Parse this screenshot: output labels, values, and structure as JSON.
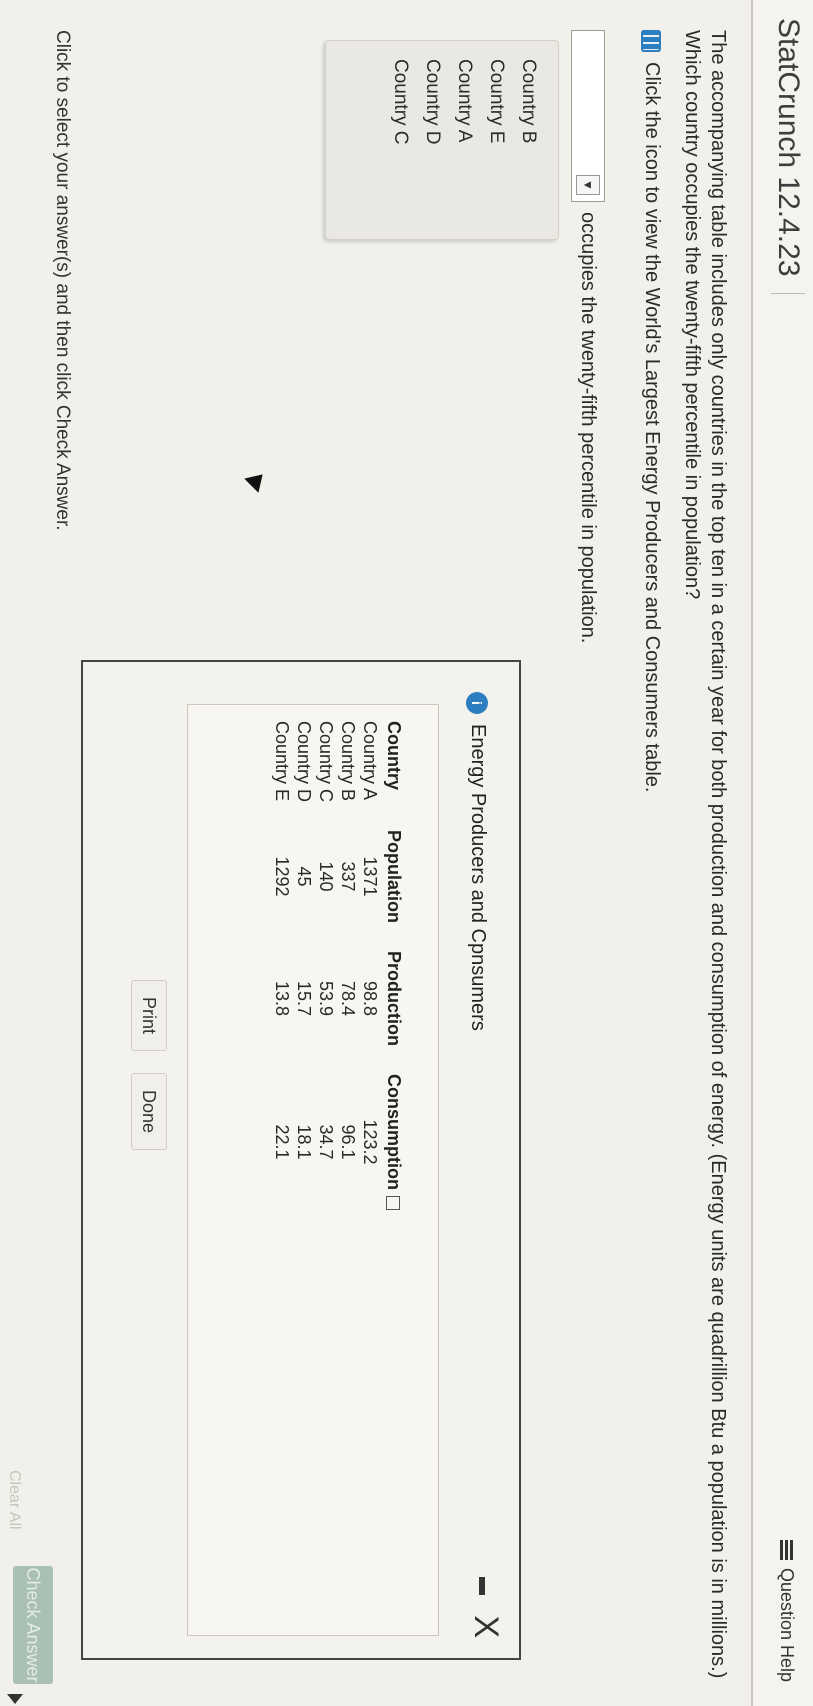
{
  "header": {
    "app_title": "StatCrunch 12.4.23",
    "question_help_label": "Question Help"
  },
  "question": {
    "text": "The accompanying table includes only countries in the top ten in a certain year for both production and consumption of energy. (Energy units are quadrillion Btu a population is in millions.) Which country occupies the twenty-fifth percentile in population?",
    "instruction": "Click the icon to view the World's Largest Energy Producers and Consumers table."
  },
  "answer": {
    "selected_value": "",
    "suffix_text": "occupies the twenty-fifth percentile in population.",
    "options": [
      "Country B",
      "Country E",
      "Country A",
      "Country D",
      "Country C"
    ]
  },
  "popup": {
    "title": "Energy Producers and Cpnsumers",
    "badge": "i",
    "close_glyph": "X",
    "table": {
      "headers": [
        "Country",
        "Population",
        "Production",
        "Consumption"
      ],
      "rows": [
        [
          "Country A",
          "1371",
          "98.8",
          "123.2"
        ],
        [
          "Country B",
          "337",
          "78.4",
          "96.1"
        ],
        [
          "Country C",
          "140",
          "53.9",
          "34.7"
        ],
        [
          "Country D",
          "45",
          "15.7",
          "18.1"
        ],
        [
          "Country E",
          "1292",
          "13.8",
          "22.1"
        ]
      ]
    },
    "print_label": "Print",
    "done_label": "Done"
  },
  "footer": {
    "instruction": "Click to select your answer(s) and then click Check Answer.",
    "check_answer_label": "Check Answer",
    "clear_all_label": "Clear All"
  }
}
